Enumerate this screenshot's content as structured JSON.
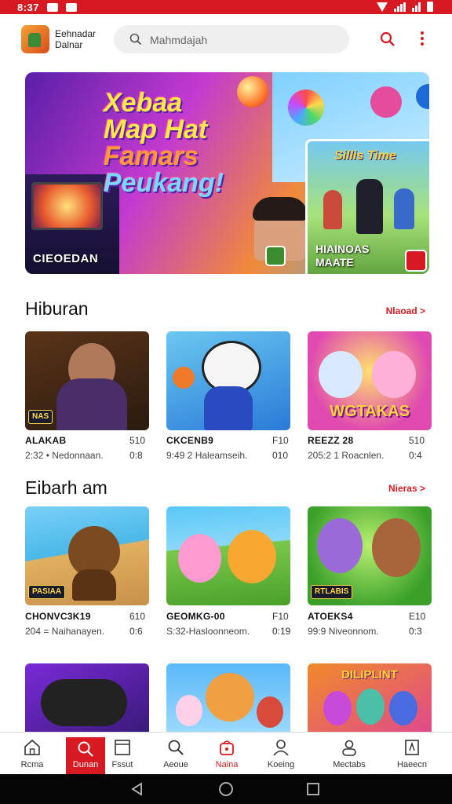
{
  "status_bar": {
    "time": "8:37"
  },
  "header": {
    "app_name_line1": "Eehnadar",
    "app_name_line2": "Dalnar",
    "search_placeholder": "Mahmdajah"
  },
  "banner": {
    "title_lines": [
      "Xebaa",
      "Map Hat",
      "Famars",
      "Peukang!"
    ],
    "caption": "CIEOEDAN",
    "sub_card_title": "Sillis Time",
    "sub_card_caption_line1": "HIAINOAS",
    "sub_card_caption_line2": "MAATE"
  },
  "sections": [
    {
      "title": "Hiburan",
      "see_more": "Nlaoad >",
      "items": [
        {
          "art_tag": "NAS",
          "art_title": "",
          "title": "ALAKAB",
          "size": "510",
          "meta": "2:32 • Nedonnaan.",
          "time": "0:8"
        },
        {
          "art_tag": "",
          "art_title": "",
          "title": "CKCENB9",
          "size": "F10",
          "meta": "9:49 2 Haleamseih.",
          "time": "010"
        },
        {
          "art_tag": "",
          "art_title": "WGTAKAS",
          "title": "REEZZ 28",
          "size": "510",
          "meta": "205:2 1 Roacnlen.",
          "time": "0:4"
        }
      ]
    },
    {
      "title": "Eibarh am",
      "see_more": "Nieras >",
      "items": [
        {
          "art_tag": "PASIAA",
          "art_title": "",
          "title": "CHONVC3K19",
          "size": "610",
          "meta": "204 = Naihanayen.",
          "time": "0:6"
        },
        {
          "art_tag": "",
          "art_title": "",
          "title": "GEOMKG-00",
          "size": "F10",
          "meta": "S:32-Hasloonneom.",
          "time": "0:19"
        },
        {
          "art_tag": "RTLABIS",
          "art_title": "",
          "title": "ATOEKS4",
          "size": "E10",
          "meta": "99:9 Niveonnom.",
          "time": "0:3"
        }
      ]
    },
    {
      "title": "",
      "see_more": "",
      "items": [
        {
          "art_tag": "",
          "art_title": "",
          "title": "",
          "size": "",
          "meta": "",
          "time": ""
        },
        {
          "art_tag": "",
          "art_title": "",
          "title": "",
          "size": "",
          "meta": "",
          "time": ""
        },
        {
          "art_tag": "",
          "art_title": "DILIPLINT",
          "title": "",
          "size": "",
          "meta": "",
          "time": ""
        }
      ]
    }
  ],
  "bottom_nav": [
    {
      "label": "Rcma",
      "icon": "home-icon",
      "active": false
    },
    {
      "label": "Dunan",
      "icon": "search-icon",
      "active": true
    },
    {
      "label": "Fssut",
      "icon": "tablet-icon",
      "active": false
    },
    {
      "label": "Aeoue",
      "icon": "search-icon",
      "active": false
    },
    {
      "label": "Naina",
      "icon": "bag-icon",
      "active": false
    },
    {
      "label": "Koeing",
      "icon": "person-icon",
      "active": false
    },
    {
      "label": "Mectabs",
      "icon": "account-icon",
      "active": false
    },
    {
      "label": "Haeecn",
      "icon": "document-icon",
      "active": false
    }
  ],
  "colors": {
    "accent": "#d71921",
    "status_bar": "#d71921",
    "system_nav": "#050505"
  }
}
